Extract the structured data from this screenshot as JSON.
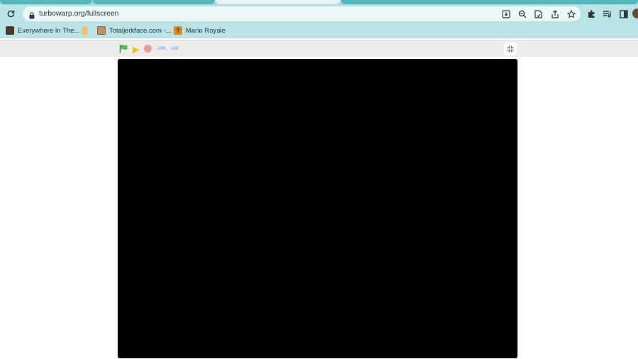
{
  "browser": {
    "url": "turbowarp.org/fullscreen"
  },
  "bookmarks": [
    {
      "label": "Everywhere In The...",
      "icon": "painting-favicon",
      "color": "#4a3a2c"
    },
    {
      "label": "",
      "icon": "note-favicon",
      "color": "#f4c06a"
    },
    {
      "label": "Totaljerkface.com -...",
      "icon": "tjf-favicon",
      "color": "#c98c5a"
    },
    {
      "label": "Mario Royale",
      "icon": "question-block-favicon",
      "color": "#e08a1e"
    }
  ],
  "player": {
    "coords": "-200, 169"
  },
  "colors": {
    "frame": "#b9e3e6",
    "flag": "#4cbf56",
    "play": "#ffbf00",
    "stop": "#ec9aa1",
    "stage": "#000000"
  }
}
